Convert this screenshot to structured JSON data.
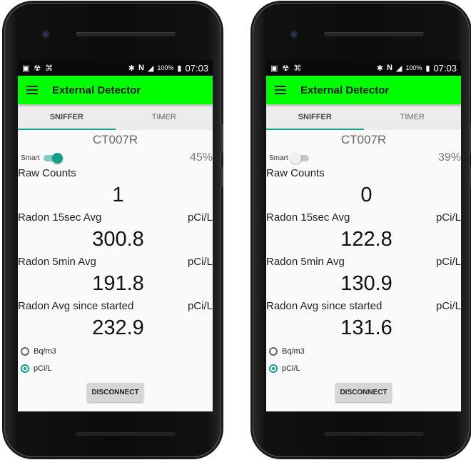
{
  "status_bar": {
    "battery_percent": "100%",
    "time": "07:03",
    "left_icons": [
      "image-icon",
      "radiation-icon",
      "wifi-icon"
    ],
    "right_icons": [
      "bluetooth-icon",
      "nfc-icon",
      "signal-icon",
      "battery-icon"
    ]
  },
  "app": {
    "title": "External Detector",
    "appbar_color": "#00ff00",
    "accent_color": "#12a08a"
  },
  "tabs": [
    "SNIFFER",
    "TIMER"
  ],
  "screens": [
    {
      "device_id": "CT007R",
      "smart_label": "Smart",
      "smart_on": true,
      "percent": "45%",
      "raw_counts_label": "Raw Counts",
      "raw_counts": "1",
      "radon_15sec_label": "Radon 15sec Avg",
      "radon_15sec_unit": "pCi/L",
      "radon_15sec": "300.8",
      "radon_5min_label": "Radon 5min Avg",
      "radon_5min_unit": "pCi/L",
      "radon_5min": "191.8",
      "radon_avg_label": "Radon Avg since started",
      "radon_avg_unit": "pCi/L",
      "radon_avg": "232.9",
      "radio_bq": "Bq/m3",
      "radio_pci": "pCi/L",
      "selected_unit": "pCi/L",
      "disconnect_label": "DISCONNECT"
    },
    {
      "device_id": "CT007R",
      "smart_label": "Smart",
      "smart_on": false,
      "percent": "39%",
      "raw_counts_label": "Raw Counts",
      "raw_counts": "0",
      "radon_15sec_label": "Radon 15sec Avg",
      "radon_15sec_unit": "pCi/L",
      "radon_15sec": "122.8",
      "radon_5min_label": "Radon 5min Avg",
      "radon_5min_unit": "pCi/L",
      "radon_5min": "130.9",
      "radon_avg_label": "Radon Avg since started",
      "radon_avg_unit": "pCi/L",
      "radon_avg": "131.6",
      "radio_bq": "Bq/m3",
      "radio_pci": "pCi/L",
      "selected_unit": "pCi/L",
      "disconnect_label": "DISCONNECT"
    }
  ]
}
